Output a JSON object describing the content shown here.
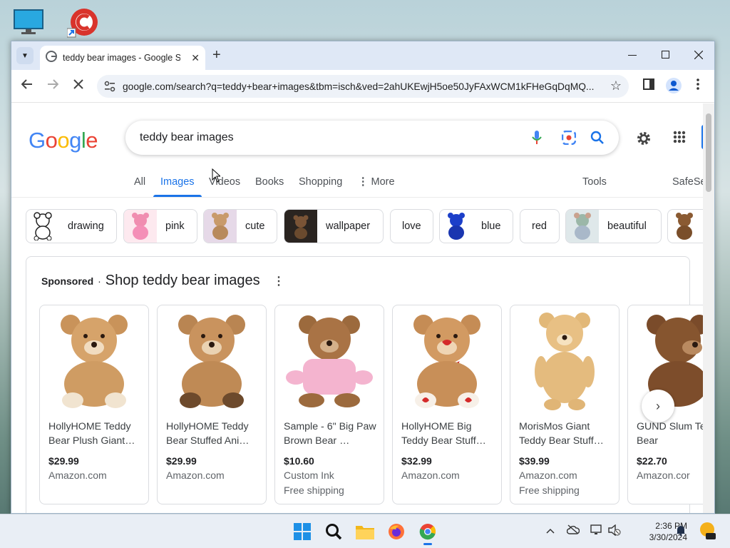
{
  "desktop": {
    "icons": [
      "monitor-icon",
      "ccleaner-icon"
    ]
  },
  "browser": {
    "tab": {
      "title": "teddy bear images - Google Se"
    },
    "address_bar": {
      "url": "google.com/search?q=teddy+bear+images&tbm=isch&ved=2ahUKEwjH5oe50JyFAxWCM1kFHeGqDqMQ..."
    }
  },
  "google": {
    "logo": "Google",
    "search": {
      "query": "teddy bear images"
    },
    "nav_tabs": [
      {
        "label": "All"
      },
      {
        "label": "Images",
        "active": true
      },
      {
        "label": "Videos"
      },
      {
        "label": "Books"
      },
      {
        "label": "Shopping"
      },
      {
        "label": "More"
      }
    ],
    "tools_label": "Tools",
    "safesearch_label": "SafeSe",
    "chips": [
      {
        "label": "drawing"
      },
      {
        "label": "pink"
      },
      {
        "label": "cute"
      },
      {
        "label": "wallpaper"
      },
      {
        "label": "love"
      },
      {
        "label": "blue"
      },
      {
        "label": "red"
      },
      {
        "label": "beautiful"
      }
    ],
    "sponsored": {
      "badge": "Sponsored",
      "separator": "·",
      "title": "Shop teddy bear images",
      "products": [
        {
          "title": "HollyHOME Teddy Bear Plush Giant…",
          "price": "$29.99",
          "seller": "Amazon.com",
          "shipping": ""
        },
        {
          "title": "HollyHOME Teddy Bear Stuffed Ani…",
          "price": "$29.99",
          "seller": "Amazon.com",
          "shipping": ""
        },
        {
          "title": "Sample - 6\" Big Paw Brown Bear …",
          "price": "$10.60",
          "seller": "Custom Ink",
          "shipping": "Free shipping"
        },
        {
          "title": "HollyHOME Big Teddy Bear Stuff…",
          "price": "$32.99",
          "seller": "Amazon.com",
          "shipping": ""
        },
        {
          "title": "MorisMos Giant Teddy Bear Stuff…",
          "price": "$39.99",
          "seller": "Amazon.com",
          "shipping": "Free shipping"
        },
        {
          "title": "GUND Slum Teddy Bear",
          "price": "$22.70",
          "seller": "Amazon.cor",
          "shipping": ""
        }
      ]
    }
  },
  "taskbar": {
    "clock": {
      "time": "2:36 PM",
      "date": "3/30/2024"
    }
  },
  "colors": {
    "google_blue": "#4285F4",
    "google_red": "#EA4335",
    "google_yellow": "#FBBC05",
    "google_green": "#34A853",
    "accent_blue": "#1a73e8"
  }
}
